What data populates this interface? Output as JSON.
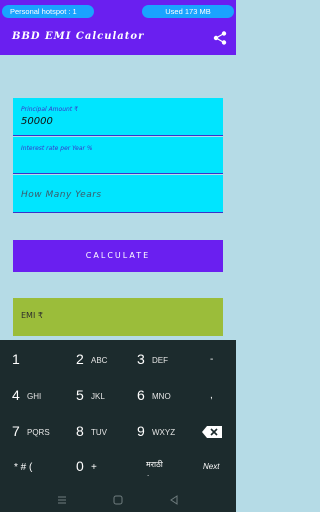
{
  "status_bar": {
    "hotspot_text": "Personal hotspot : 1",
    "usage_text": "Used  173 MB"
  },
  "app_bar": {
    "title": "BBD EMI Calculator",
    "share_icon": "share-icon"
  },
  "form": {
    "principal_label": "Principal Amount ₹",
    "principal_value": "50000",
    "interest_label": "Interest rate per Year %",
    "years_placeholder": "How Many Years",
    "calculate_label": "CALCULATE",
    "emi_label": "EMI ₹"
  },
  "keypad": {
    "keys": [
      {
        "digit": "1",
        "letters": ""
      },
      {
        "digit": "2",
        "letters": "ABC"
      },
      {
        "digit": "3",
        "letters": "DEF"
      },
      {
        "digit": "4",
        "letters": "GHI"
      },
      {
        "digit": "5",
        "letters": "JKL"
      },
      {
        "digit": "6",
        "letters": "MNO"
      },
      {
        "digit": "7",
        "letters": "PQRS"
      },
      {
        "digit": "8",
        "letters": "TUV"
      },
      {
        "digit": "9",
        "letters": "WXYZ"
      }
    ],
    "symbols_label": "* # (",
    "zero_label": "0",
    "plus_label": "+",
    "language_label": "मराठी",
    "next_label": "Next",
    "hyphen_label": "-",
    "comma_label": ",",
    "dot_label": ".",
    "backspace_icon": "backspace-icon"
  },
  "nav": {
    "menu_icon": "menu-icon",
    "home_icon": "home-icon",
    "back_icon": "back-icon"
  },
  "colors": {
    "primary": "#6a1ff0",
    "field_bg": "#00e5ff",
    "result_bg": "#9bbd3a",
    "page_bg": "#b5dbe6",
    "keypad_bg": "#1c2b2d"
  }
}
